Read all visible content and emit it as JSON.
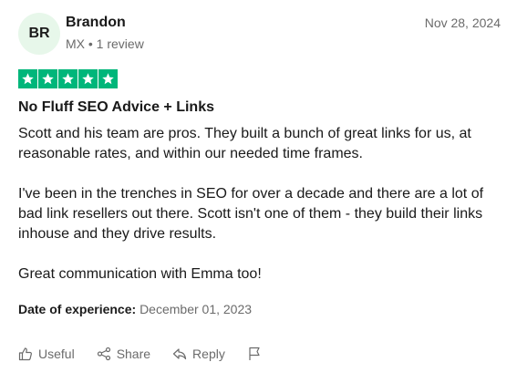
{
  "reviewer": {
    "initials": "BR",
    "name": "Brandon",
    "meta": "MX • 1 review"
  },
  "review": {
    "date": "Nov 28, 2024",
    "rating": 5,
    "title": "No Fluff SEO Advice + Links",
    "paragraphs": [
      "Scott and his team are pros. They built a bunch of great links for us, at reasonable rates, and within our needed time frames.",
      "I've been in the trenches in SEO for over a decade and there are a lot of bad link resellers out there. Scott isn't one of them - they build their links inhouse and they drive results.",
      "Great communication with Emma too!"
    ],
    "experience_label": "Date of experience:",
    "experience_date": "December 01, 2023"
  },
  "actions": {
    "useful": "Useful",
    "share": "Share",
    "reply": "Reply"
  },
  "colors": {
    "star_green": "#00b67a",
    "avatar_bg": "#e7f7ea"
  },
  "icons": [
    "thumbs-up-icon",
    "share-icon",
    "reply-icon",
    "flag-icon",
    "star-icon"
  ]
}
